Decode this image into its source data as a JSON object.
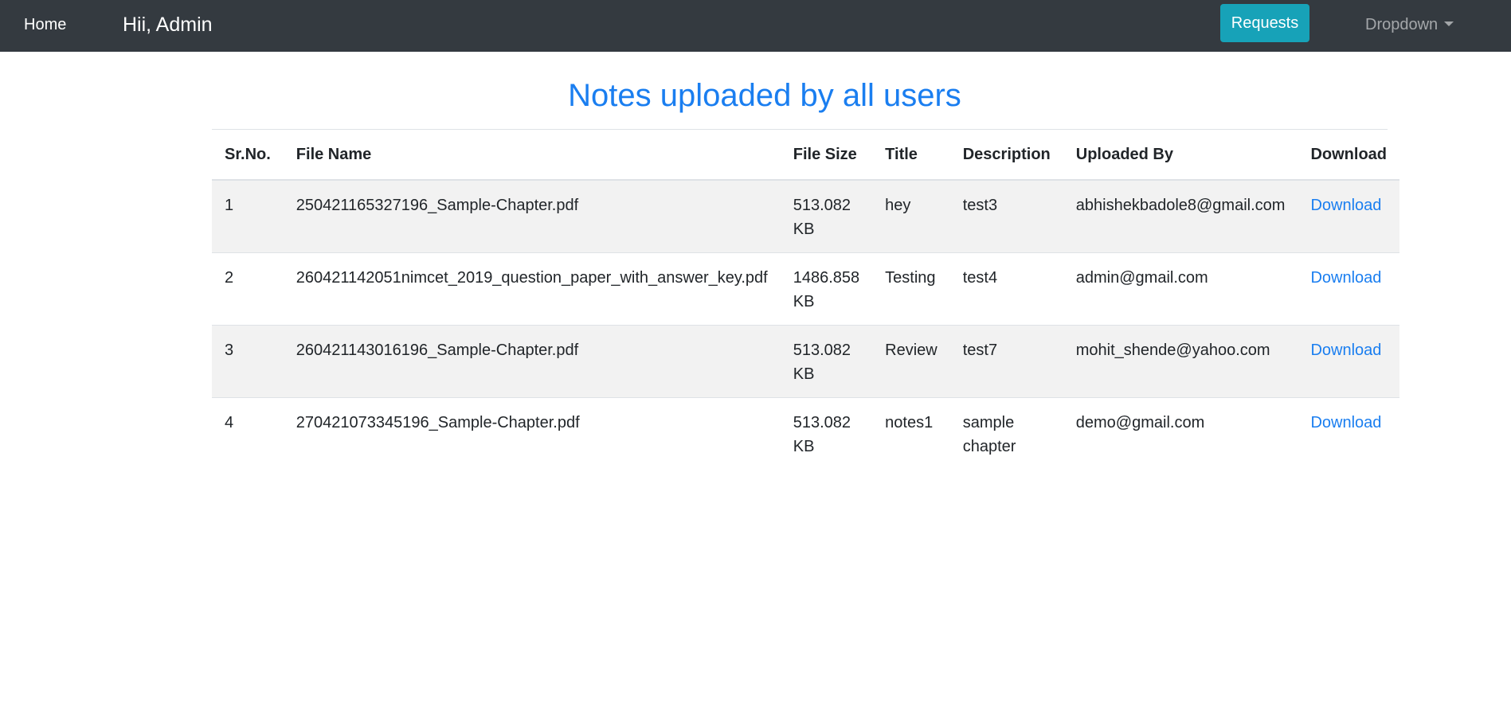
{
  "navbar": {
    "home_label": "Home",
    "greeting": "Hii, Admin",
    "requests_label": "Requests",
    "dropdown_label": "Dropdown"
  },
  "page": {
    "title": "Notes uploaded by all users"
  },
  "table": {
    "headers": {
      "sr_no": "Sr.No.",
      "file_name": "File Name",
      "file_size": "File Size",
      "title": "Title",
      "description": "Description",
      "uploaded_by": "Uploaded By",
      "download": "Download"
    },
    "rows": [
      {
        "sr_no": "1",
        "file_name": "250421165327196_Sample-Chapter.pdf",
        "file_size_value": "513.082",
        "file_size_unit": "KB",
        "title": "hey",
        "description": "test3",
        "uploaded_by": "abhishekbadole8@gmail.com",
        "download": "Download"
      },
      {
        "sr_no": "2",
        "file_name": "260421142051nimcet_2019_question_paper_with_answer_key.pdf",
        "file_size_value": "1486.858",
        "file_size_unit": "KB",
        "title": "Testing",
        "description": "test4",
        "uploaded_by": "admin@gmail.com",
        "download": "Download"
      },
      {
        "sr_no": "3",
        "file_name": "260421143016196_Sample-Chapter.pdf",
        "file_size_value": "513.082",
        "file_size_unit": "KB",
        "title": "Review",
        "description": "test7",
        "uploaded_by": "mohit_shende@yahoo.com",
        "download": "Download"
      },
      {
        "sr_no": "4",
        "file_name": "270421073345196_Sample-Chapter.pdf",
        "file_size_value": "513.082",
        "file_size_unit": "KB",
        "title": "notes1",
        "description": "sample chapter",
        "uploaded_by": "demo@gmail.com",
        "download": "Download"
      }
    ]
  },
  "colors": {
    "navbar_bg": "#343a40",
    "accent_blue": "#1a7ef0",
    "requests_button": "#17a2b8",
    "stripe": "#f2f2f2"
  }
}
